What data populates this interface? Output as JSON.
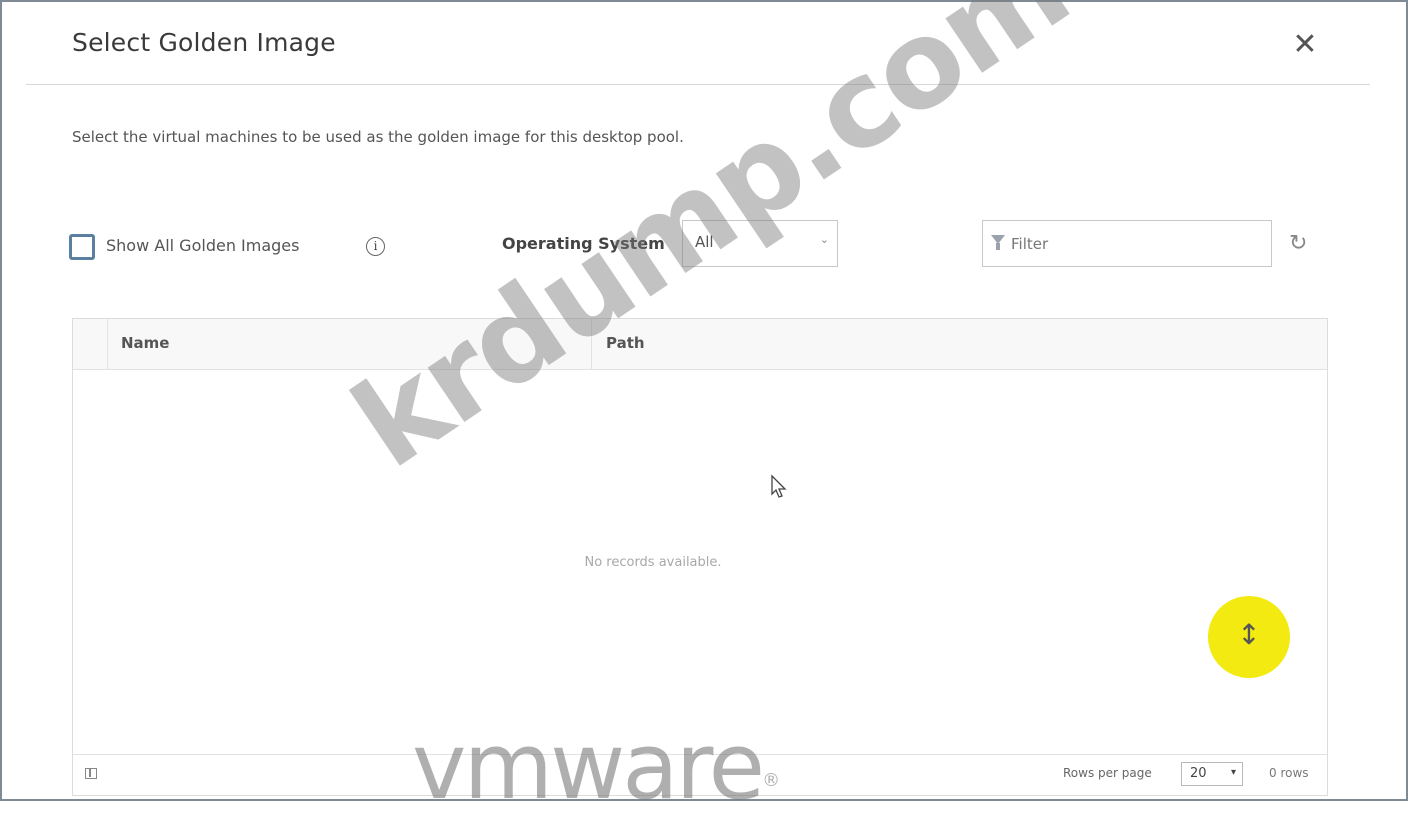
{
  "dialog": {
    "title": "Select Golden Image",
    "close_icon": "close-icon",
    "description": "Select the virtual machines to be used as the golden image for this desktop pool."
  },
  "toolbar": {
    "show_all_label": "Show All Golden Images",
    "show_all_checked": false,
    "info_icon": "info-icon",
    "os_label": "Operating System",
    "os_value": "All",
    "filter_placeholder": "Filter",
    "refresh_icon": "refresh-icon"
  },
  "grid": {
    "columns": [
      "Name",
      "Path"
    ],
    "empty_message": "No records available.",
    "footer": {
      "rows_per_page_label": "Rows per page",
      "rows_per_page_value": "20",
      "rows_count": "0 rows"
    }
  },
  "overlay": {
    "watermark": "krdump.com",
    "logo_text": "vmware",
    "logo_mark": "®",
    "highlight_color": "#f2ea10"
  }
}
